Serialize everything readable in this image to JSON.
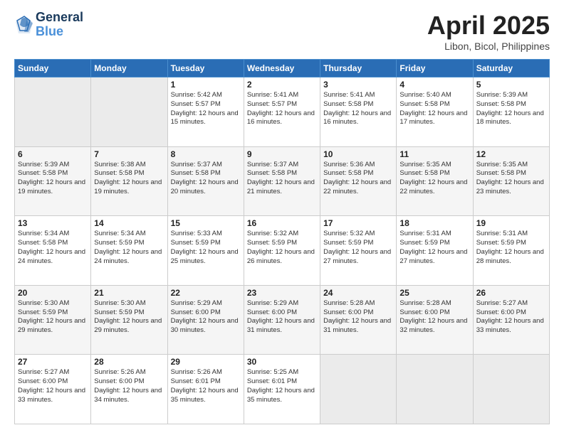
{
  "header": {
    "logo_line1": "General",
    "logo_line2": "Blue",
    "month_title": "April 2025",
    "location": "Libon, Bicol, Philippines"
  },
  "weekdays": [
    "Sunday",
    "Monday",
    "Tuesday",
    "Wednesday",
    "Thursday",
    "Friday",
    "Saturday"
  ],
  "weeks": [
    [
      {
        "day": "",
        "empty": true
      },
      {
        "day": "",
        "empty": true
      },
      {
        "day": "1",
        "sunrise": "5:42 AM",
        "sunset": "5:57 PM",
        "daylight": "12 hours and 15 minutes."
      },
      {
        "day": "2",
        "sunrise": "5:41 AM",
        "sunset": "5:57 PM",
        "daylight": "12 hours and 16 minutes."
      },
      {
        "day": "3",
        "sunrise": "5:41 AM",
        "sunset": "5:58 PM",
        "daylight": "12 hours and 16 minutes."
      },
      {
        "day": "4",
        "sunrise": "5:40 AM",
        "sunset": "5:58 PM",
        "daylight": "12 hours and 17 minutes."
      },
      {
        "day": "5",
        "sunrise": "5:39 AM",
        "sunset": "5:58 PM",
        "daylight": "12 hours and 18 minutes."
      }
    ],
    [
      {
        "day": "6",
        "sunrise": "5:39 AM",
        "sunset": "5:58 PM",
        "daylight": "12 hours and 19 minutes."
      },
      {
        "day": "7",
        "sunrise": "5:38 AM",
        "sunset": "5:58 PM",
        "daylight": "12 hours and 19 minutes."
      },
      {
        "day": "8",
        "sunrise": "5:37 AM",
        "sunset": "5:58 PM",
        "daylight": "12 hours and 20 minutes."
      },
      {
        "day": "9",
        "sunrise": "5:37 AM",
        "sunset": "5:58 PM",
        "daylight": "12 hours and 21 minutes."
      },
      {
        "day": "10",
        "sunrise": "5:36 AM",
        "sunset": "5:58 PM",
        "daylight": "12 hours and 22 minutes."
      },
      {
        "day": "11",
        "sunrise": "5:35 AM",
        "sunset": "5:58 PM",
        "daylight": "12 hours and 22 minutes."
      },
      {
        "day": "12",
        "sunrise": "5:35 AM",
        "sunset": "5:58 PM",
        "daylight": "12 hours and 23 minutes."
      }
    ],
    [
      {
        "day": "13",
        "sunrise": "5:34 AM",
        "sunset": "5:58 PM",
        "daylight": "12 hours and 24 minutes."
      },
      {
        "day": "14",
        "sunrise": "5:34 AM",
        "sunset": "5:59 PM",
        "daylight": "12 hours and 24 minutes."
      },
      {
        "day": "15",
        "sunrise": "5:33 AM",
        "sunset": "5:59 PM",
        "daylight": "12 hours and 25 minutes."
      },
      {
        "day": "16",
        "sunrise": "5:32 AM",
        "sunset": "5:59 PM",
        "daylight": "12 hours and 26 minutes."
      },
      {
        "day": "17",
        "sunrise": "5:32 AM",
        "sunset": "5:59 PM",
        "daylight": "12 hours and 27 minutes."
      },
      {
        "day": "18",
        "sunrise": "5:31 AM",
        "sunset": "5:59 PM",
        "daylight": "12 hours and 27 minutes."
      },
      {
        "day": "19",
        "sunrise": "5:31 AM",
        "sunset": "5:59 PM",
        "daylight": "12 hours and 28 minutes."
      }
    ],
    [
      {
        "day": "20",
        "sunrise": "5:30 AM",
        "sunset": "5:59 PM",
        "daylight": "12 hours and 29 minutes."
      },
      {
        "day": "21",
        "sunrise": "5:30 AM",
        "sunset": "5:59 PM",
        "daylight": "12 hours and 29 minutes."
      },
      {
        "day": "22",
        "sunrise": "5:29 AM",
        "sunset": "6:00 PM",
        "daylight": "12 hours and 30 minutes."
      },
      {
        "day": "23",
        "sunrise": "5:29 AM",
        "sunset": "6:00 PM",
        "daylight": "12 hours and 31 minutes."
      },
      {
        "day": "24",
        "sunrise": "5:28 AM",
        "sunset": "6:00 PM",
        "daylight": "12 hours and 31 minutes."
      },
      {
        "day": "25",
        "sunrise": "5:28 AM",
        "sunset": "6:00 PM",
        "daylight": "12 hours and 32 minutes."
      },
      {
        "day": "26",
        "sunrise": "5:27 AM",
        "sunset": "6:00 PM",
        "daylight": "12 hours and 33 minutes."
      }
    ],
    [
      {
        "day": "27",
        "sunrise": "5:27 AM",
        "sunset": "6:00 PM",
        "daylight": "12 hours and 33 minutes."
      },
      {
        "day": "28",
        "sunrise": "5:26 AM",
        "sunset": "6:00 PM",
        "daylight": "12 hours and 34 minutes."
      },
      {
        "day": "29",
        "sunrise": "5:26 AM",
        "sunset": "6:01 PM",
        "daylight": "12 hours and 35 minutes."
      },
      {
        "day": "30",
        "sunrise": "5:25 AM",
        "sunset": "6:01 PM",
        "daylight": "12 hours and 35 minutes."
      },
      {
        "day": "",
        "empty": true
      },
      {
        "day": "",
        "empty": true
      },
      {
        "day": "",
        "empty": true
      }
    ]
  ]
}
